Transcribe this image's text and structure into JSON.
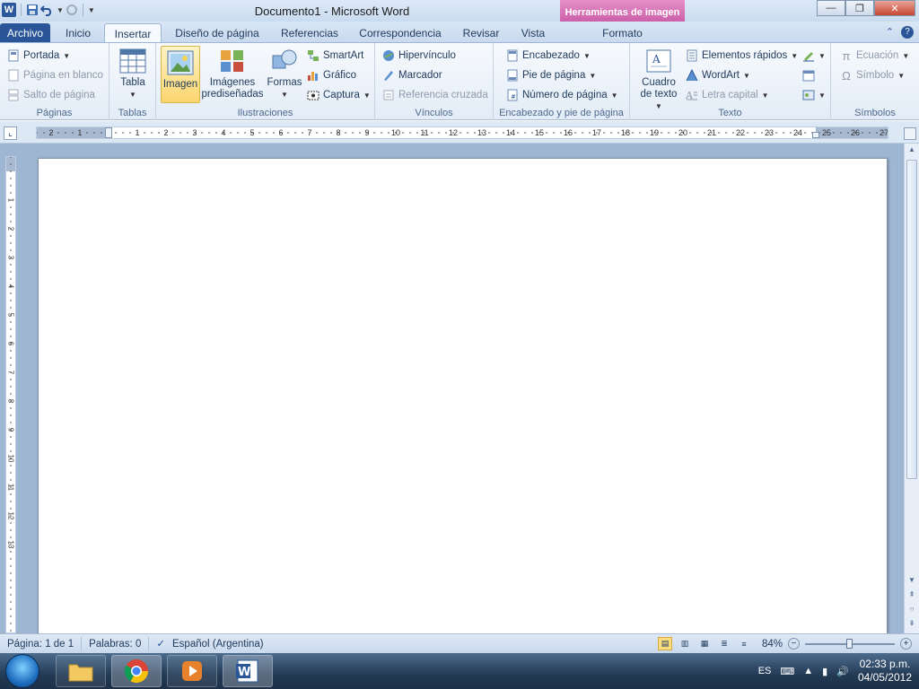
{
  "window": {
    "title": "Documento1  -  Microsoft Word",
    "context_header": "Herramientas de imagen"
  },
  "qat": {
    "app_letter": "W",
    "save_icon": "save-icon",
    "undo_icon": "undo-icon",
    "redo_icon": "redo-icon",
    "customize_icon": "chevron-down-icon"
  },
  "tabs": [
    {
      "label": "Archivo"
    },
    {
      "label": "Inicio"
    },
    {
      "label": "Insertar"
    },
    {
      "label": "Diseño de página"
    },
    {
      "label": "Referencias"
    },
    {
      "label": "Correspondencia"
    },
    {
      "label": "Revisar"
    },
    {
      "label": "Vista"
    },
    {
      "label": "Formato"
    }
  ],
  "ribbon": {
    "paginas": {
      "label": "Páginas",
      "portada": "Portada",
      "pagina_blanco": "Página en blanco",
      "salto": "Salto de página"
    },
    "tablas": {
      "label": "Tablas",
      "tabla": "Tabla"
    },
    "ilustraciones": {
      "label": "Ilustraciones",
      "imagen": "Imagen",
      "imagenes_1": "Imágenes",
      "imagenes_2": "prediseñadas",
      "formas": "Formas",
      "smartart": "SmartArt",
      "grafico": "Gráfico",
      "captura": "Captura"
    },
    "vinculos": {
      "label": "Vínculos",
      "hipervinculo": "Hipervínculo",
      "marcador": "Marcador",
      "referencia": "Referencia cruzada"
    },
    "encabezado": {
      "label": "Encabezado y pie de página",
      "encabezado": "Encabezado",
      "pie": "Pie de página",
      "numero": "Número de página"
    },
    "texto": {
      "label": "Texto",
      "cuadro_1": "Cuadro",
      "cuadro_2": "de texto",
      "elementos": "Elementos rápidos",
      "wordart": "WordArt",
      "letra": "Letra capital"
    },
    "simbolos": {
      "label": "Símbolos",
      "ecuacion": "Ecuación",
      "simbolo": "Símbolo"
    }
  },
  "ruler": {
    "h_labels": [
      "2",
      "1",
      "1",
      "2",
      "3",
      "4",
      "5",
      "6",
      "7",
      "8",
      "9",
      "10",
      "11",
      "12",
      "13",
      "14",
      "15",
      "16",
      "17",
      "18",
      "19",
      "20",
      "21",
      "22",
      "23",
      "24",
      "25",
      "26",
      "27"
    ],
    "v_labels": [
      "2",
      "1",
      "1",
      "2",
      "3",
      "4",
      "5",
      "6",
      "7",
      "8",
      "9",
      "10",
      "11",
      "12",
      "13"
    ]
  },
  "status": {
    "pagina": "Página: 1 de 1",
    "palabras": "Palabras: 0",
    "idioma": "Español (Argentina)",
    "zoom": "84%",
    "zoom_value": 84
  },
  "taskbar": {
    "lang": "ES",
    "time": "02:33 p.m.",
    "date": "04/05/2012"
  },
  "colors": {
    "file_tab": "#2a5699",
    "context_tab": "#c95ba6",
    "selected_button": "#fbd56e"
  }
}
